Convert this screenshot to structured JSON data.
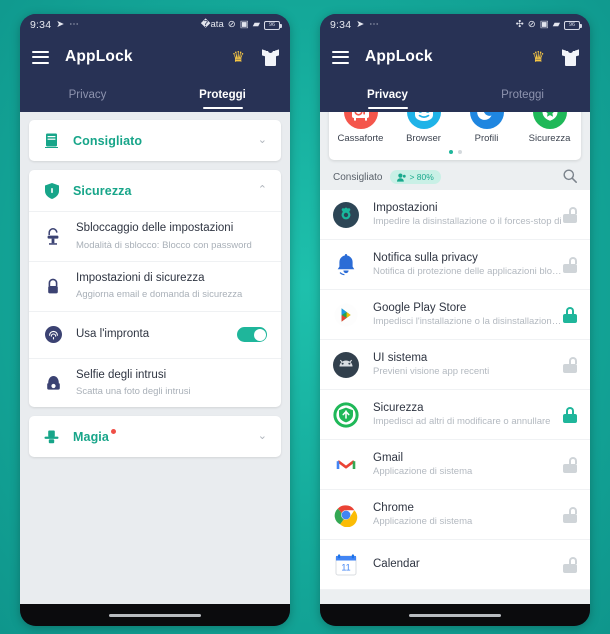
{
  "theme": {
    "background_teal": "#14a899",
    "appbar_navy": "#283255",
    "accent_green": "#17a589",
    "toggle_on": "#1fb69b",
    "badge_red": "#ef4e46",
    "crown_gold": "#f6c644"
  },
  "status_bar": {
    "time": "9:34",
    "icons": [
      "send-icon",
      "more-icon",
      "bluetooth-icon",
      "dnd-icon",
      "vibrate-icon",
      "wifi-icon",
      "battery-icon"
    ],
    "battery_level": "96"
  },
  "app_bar": {
    "menu_icon": "hamburger-menu-icon",
    "title": "AppLock",
    "premium_icon": "crown-icon",
    "theme_icon": "tshirt-icon"
  },
  "left_phone": {
    "tabs": [
      {
        "label": "Privacy",
        "active": false
      },
      {
        "label": "Proteggi",
        "active": true
      }
    ],
    "sections": [
      {
        "id": "consigliato",
        "icon": "book-icon",
        "title": "Consigliato",
        "expanded": false,
        "chevron": "chevron-down-icon",
        "badge": false,
        "rows": []
      },
      {
        "id": "sicurezza",
        "icon": "shield-icon",
        "title": "Sicurezza",
        "expanded": true,
        "chevron": "chevron-up-icon",
        "badge": false,
        "rows": [
          {
            "icon": "unlock-settings-icon",
            "title": "Sbloccaggio delle impostazioni",
            "subtitle": "Modalità di sblocco: Blocco con password",
            "control": "none"
          },
          {
            "icon": "lock-settings-icon",
            "title": "Impostazioni di sicurezza",
            "subtitle": "Aggiorna email e domanda di sicurezza",
            "control": "none"
          },
          {
            "icon": "fingerprint-icon",
            "title": "Usa l'impronta",
            "subtitle": "",
            "control": "toggle",
            "toggle_on": true
          },
          {
            "icon": "intruder-selfie-icon",
            "title": "Selfie degli intrusi",
            "subtitle": "Scatta una foto degli intrusi",
            "control": "none"
          }
        ]
      },
      {
        "id": "magia",
        "icon": "magic-hat-icon",
        "title": "Magia",
        "expanded": false,
        "chevron": "chevron-down-icon",
        "badge": true,
        "rows": []
      }
    ]
  },
  "right_phone": {
    "tabs": [
      {
        "label": "Privacy",
        "active": true
      },
      {
        "label": "Proteggi",
        "active": false
      }
    ],
    "carousel": {
      "items": [
        {
          "label": "Cassaforte",
          "icon": "safe-icon",
          "color": "#f4564c"
        },
        {
          "label": "Browser",
          "icon": "browser-face-icon",
          "color": "#1fb3e8"
        },
        {
          "label": "Profili",
          "icon": "moon-star-icon",
          "color": "#1f86e0"
        },
        {
          "label": "Sicurezza",
          "icon": "shield-star-icon",
          "color": "#1fb858"
        }
      ],
      "page_dots": 2,
      "active_dot": 0
    },
    "list_header": {
      "label": "Consigliato",
      "badge_icon": "people-icon",
      "badge_text": "> 80%",
      "search_icon": "search-icon"
    },
    "apps": [
      {
        "name": "Impostazioni",
        "desc": "Impedire la disinstallazione o il forces-stop di",
        "icon": "settings-gear-icon",
        "locked": false
      },
      {
        "name": "Notifica sulla privacy",
        "desc": "Notifica di protezione delle applicazioni bloccate",
        "icon": "bell-icon",
        "locked": false
      },
      {
        "name": "Google Play Store",
        "desc": "Impedisci l'installazione o la disinstallazione di",
        "icon": "play-store-icon",
        "locked": true
      },
      {
        "name": "UI sistema",
        "desc": "Previeni visione app recenti",
        "icon": "android-system-ui-icon",
        "locked": false
      },
      {
        "name": "Sicurezza",
        "desc": "Impedisci ad altri di modificare o annullare",
        "icon": "security-shield-icon",
        "locked": true
      },
      {
        "name": "Gmail",
        "desc": "Applicazione di sistema",
        "icon": "gmail-icon",
        "locked": false
      },
      {
        "name": "Chrome",
        "desc": "Applicazione di sistema",
        "icon": "chrome-icon",
        "locked": false
      },
      {
        "name": "Calendar",
        "desc": "",
        "icon": "calendar-icon",
        "locked": false
      }
    ]
  },
  "nav_bar": {
    "handle": "home-gesture-handle"
  }
}
